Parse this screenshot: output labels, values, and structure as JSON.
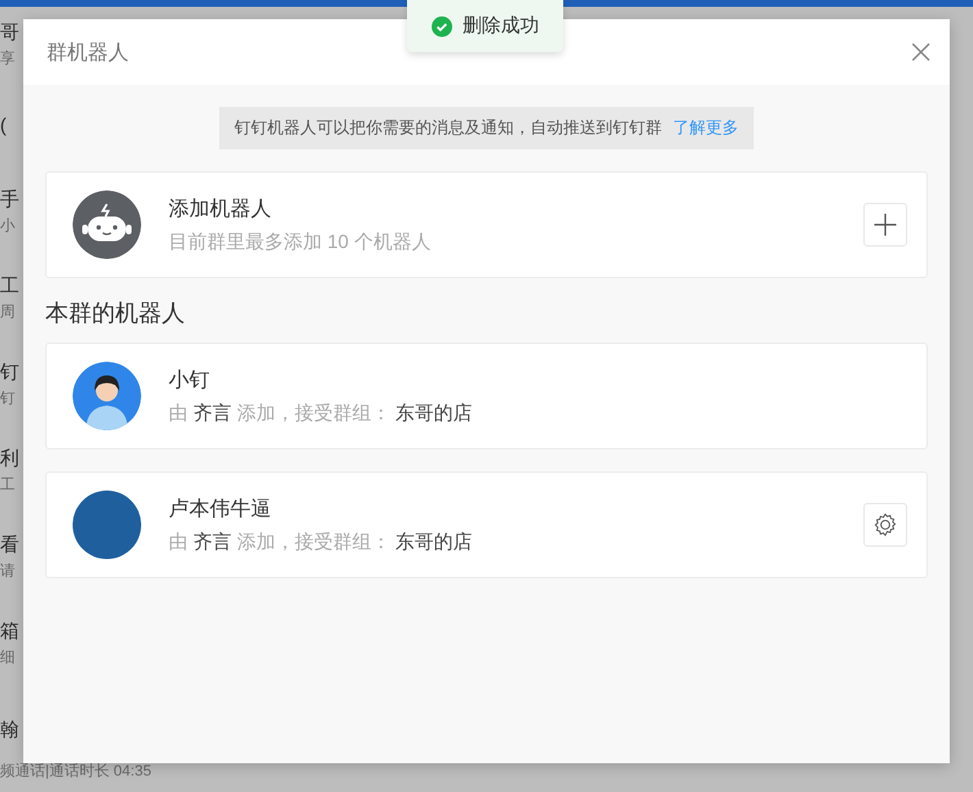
{
  "background": {
    "items": [
      {
        "title": "哥",
        "subtitle": "享"
      },
      {
        "title": "("
      },
      {
        "title": "手",
        "subtitle": "小"
      },
      {
        "title": "工",
        "subtitle": "周"
      },
      {
        "title": "钉",
        "subtitle": "钉"
      },
      {
        "title": "利",
        "subtitle": "工"
      },
      {
        "title": "看",
        "subtitle": "请"
      },
      {
        "title": "箱",
        "subtitle": "细"
      },
      {
        "title": "翰"
      }
    ],
    "footer": "频通话|通话时长 04:35"
  },
  "toast": {
    "text": "删除成功"
  },
  "dialog": {
    "title": "群机器人",
    "notice": {
      "text": "钉钉机器人可以把你需要的消息及通知，自动推送到钉钉群",
      "link": "了解更多"
    },
    "add_robot": {
      "title": "添加机器人",
      "subtitle": "目前群里最多添加 10 个机器人"
    },
    "section_title": "本群的机器人",
    "robots": [
      {
        "name": "小钉",
        "prefix": "由",
        "adder": "齐言",
        "middle": "添加，接受群组：",
        "group": "东哥的店",
        "kind": "illustration",
        "settings": false
      },
      {
        "name": "卢本伟牛逼",
        "prefix": "由",
        "adder": "齐言",
        "middle": "添加，接受群组：",
        "group": "东哥的店",
        "kind": "photo",
        "settings": true
      }
    ]
  }
}
